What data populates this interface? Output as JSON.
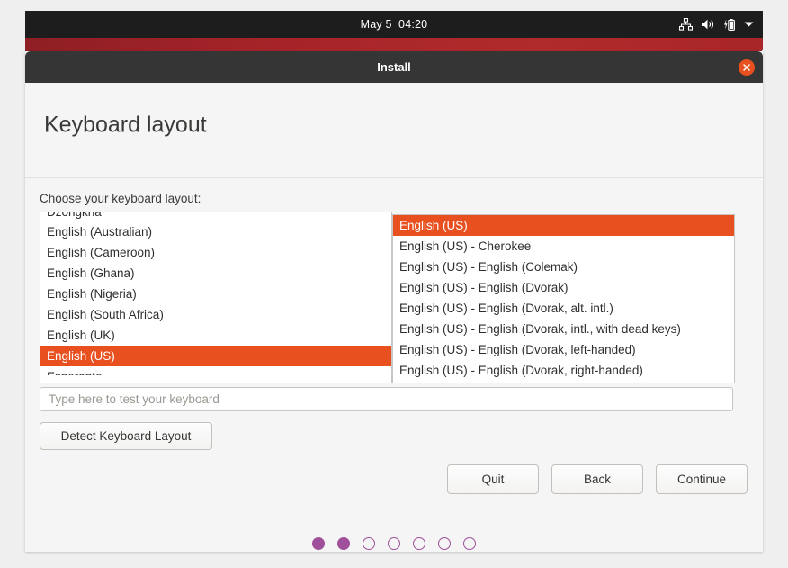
{
  "desktop": {
    "panel": {
      "clock": "May 5  04:20",
      "indicators": [
        {
          "name": "network-icon",
          "label": "Network"
        },
        {
          "name": "volume-icon",
          "label": "Volume"
        },
        {
          "name": "battery-icon",
          "label": "Battery charging"
        },
        {
          "name": "chevron-down-icon",
          "label": "System menu"
        }
      ]
    }
  },
  "window": {
    "title": "Install",
    "close_label": "Close"
  },
  "page": {
    "title": "Keyboard layout",
    "instruction": "Choose your keyboard layout:"
  },
  "layout_list": {
    "selected": "English (US)",
    "items": [
      {
        "label": "Dzongkha",
        "selected": false,
        "clipped": "top"
      },
      {
        "label": "English (Australian)",
        "selected": false
      },
      {
        "label": "English (Cameroon)",
        "selected": false
      },
      {
        "label": "English (Ghana)",
        "selected": false
      },
      {
        "label": "English (Nigeria)",
        "selected": false
      },
      {
        "label": "English (South Africa)",
        "selected": false
      },
      {
        "label": "English (UK)",
        "selected": false
      },
      {
        "label": "English (US)",
        "selected": true
      },
      {
        "label": "Esperanto",
        "selected": false,
        "clipped": "bottom"
      }
    ]
  },
  "variant_list": {
    "selected": "English (US)",
    "items": [
      {
        "label": "English (US)",
        "selected": true
      },
      {
        "label": "English (US) - Cherokee",
        "selected": false
      },
      {
        "label": "English (US) - English (Colemak)",
        "selected": false
      },
      {
        "label": "English (US) - English (Dvorak)",
        "selected": false
      },
      {
        "label": "English (US) - English (Dvorak, alt. intl.)",
        "selected": false
      },
      {
        "label": "English (US) - English (Dvorak, intl., with dead keys)",
        "selected": false
      },
      {
        "label": "English (US) - English (Dvorak, left-handed)",
        "selected": false
      },
      {
        "label": "English (US) - English (Dvorak, right-handed)",
        "selected": false
      }
    ]
  },
  "test_field": {
    "value": "",
    "placeholder": "Type here to test your keyboard"
  },
  "buttons": {
    "detect": "Detect Keyboard Layout",
    "quit": "Quit",
    "back": "Back",
    "continue": "Continue"
  },
  "progress": {
    "total": 7,
    "completed": 2,
    "dots": [
      "filled",
      "filled",
      "empty",
      "empty",
      "empty",
      "empty",
      "empty"
    ]
  },
  "colors": {
    "accent_orange": "#e8501f",
    "progress_purple": "#a0509a",
    "titlebar": "#353535",
    "panel": "#1d1d1d",
    "window_bg": "#f5f5f5",
    "strip_red": "#a62429"
  }
}
